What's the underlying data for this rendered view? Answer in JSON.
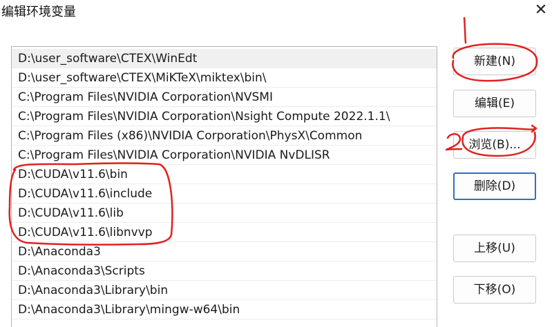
{
  "window": {
    "title": "编辑环境变量",
    "close_glyph": "✕"
  },
  "path_list": {
    "items": [
      "D:\\user_software\\CTEX\\WinEdt",
      "D:\\user_software\\CTEX\\MiKTeX\\miktex\\bin\\",
      "C:\\Program Files\\NVIDIA Corporation\\NVSMI",
      "C:\\Program Files\\NVIDIA Corporation\\Nsight Compute 2022.1.1\\",
      "C:\\Program Files (x86)\\NVIDIA Corporation\\PhysX\\Common",
      "C:\\Program Files\\NVIDIA Corporation\\NVIDIA NvDLISR",
      "D:\\CUDA\\v11.6\\bin",
      "D:\\CUDA\\v11.6\\include",
      "D:\\CUDA\\v11.6\\lib",
      "D:\\CUDA\\v11.6\\libnvvp",
      "D:\\Anaconda3",
      "D:\\Anaconda3\\Scripts",
      "D:\\Anaconda3\\Library\\bin",
      "D:\\Anaconda3\\Library\\mingw-w64\\bin"
    ]
  },
  "buttons": {
    "new": "新建(N)",
    "edit": "编辑(E)",
    "browse": "浏览(B)...",
    "delete": "删除(D)",
    "move_up": "上移(U)",
    "move_down": "下移(O)"
  },
  "annotations": {
    "color": "#e02020",
    "mark_one": "1",
    "mark_two": "2"
  }
}
